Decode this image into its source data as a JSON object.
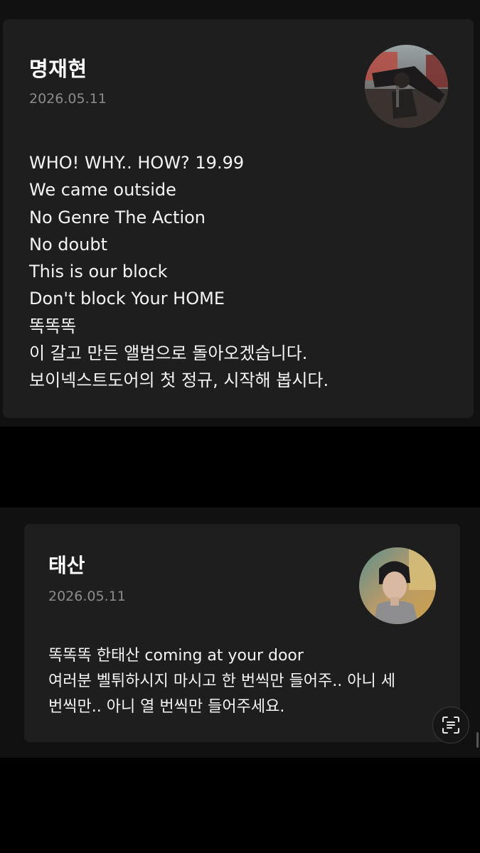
{
  "posts": [
    {
      "author": "명재현",
      "date": "2026.05.11",
      "lines": [
        "WHO! WHY.. HOW? 19.99",
        "We came outside",
        "No Genre The Action",
        "No doubt",
        "This is our block",
        "Don't block Your HOME",
        "똑똑똑",
        "이 갈고 만든 앨범으로 돌아오겠습니다.",
        "보이넥스트도어의 첫 정규, 시작해 봅시다."
      ]
    },
    {
      "author": "태산",
      "date": "2026.05.11",
      "lines": [
        "똑똑똑 한태산 coming at your door",
        "여러분 벨튀하시지 마시고 한 번씩만 들어주.. 아니 세",
        "번씩만.. 아니 열 번씩만 들어주세요."
      ]
    }
  ],
  "floating_button": {
    "icon": "text-scan-icon"
  },
  "colors": {
    "background": "#000000",
    "panel": "#111111",
    "card": "#1e1e1e",
    "text": "#f4f4f4",
    "muted": "#8c8c8c"
  }
}
